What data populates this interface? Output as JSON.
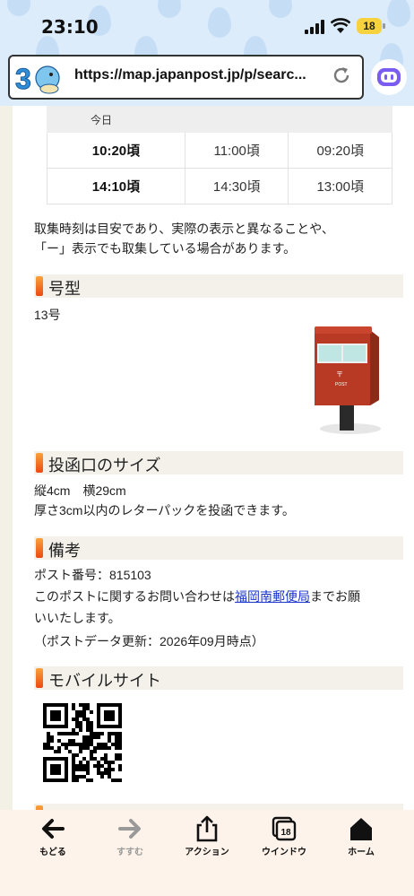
{
  "status_bar": {
    "time": "23:10",
    "battery": "18"
  },
  "browser": {
    "url": "https://map.japanpost.jp/p/searc..."
  },
  "collection_table": {
    "header_today": "今日",
    "rows": [
      {
        "today": "10:20頃",
        "col2": "11:00頃",
        "col3": "09:20頃"
      },
      {
        "today": "14:10頃",
        "col2": "14:30頃",
        "col3": "13:00頃"
      }
    ]
  },
  "collection_note": {
    "line1": "取集時刻は目安であり、実際の表示と異なることや、",
    "line2": "「ー」表示でも取集している場合があります。"
  },
  "sections": {
    "model": {
      "title": "号型",
      "value": "13号"
    },
    "slot_size": {
      "title": "投函口のサイズ",
      "line1": "縦4cm　横29cm",
      "line2": "厚さ3cm以内のレターパックを投函できます。"
    },
    "remarks": {
      "title": "備考",
      "post_number": "ポスト番号：815103",
      "contact_prefix": "このポストに関するお問い合わせは",
      "contact_link": "福岡南郵便局",
      "contact_suffix": "までお願",
      "contact_line2": "いいたします。",
      "updated": "（ポストデータ更新：2026年09月時点）"
    },
    "mobile": {
      "title": "モバイルサイト"
    }
  },
  "postbox_label": "POST",
  "toolbar": {
    "back": "もどる",
    "forward": "すすむ",
    "action": "アクション",
    "windows": "ウインドウ",
    "windows_count": "18",
    "home": "ホーム"
  },
  "colors": {
    "accent_orange": "#ec4a12",
    "link_blue": "#1a34c9",
    "postbox_red": "#c2402a"
  }
}
